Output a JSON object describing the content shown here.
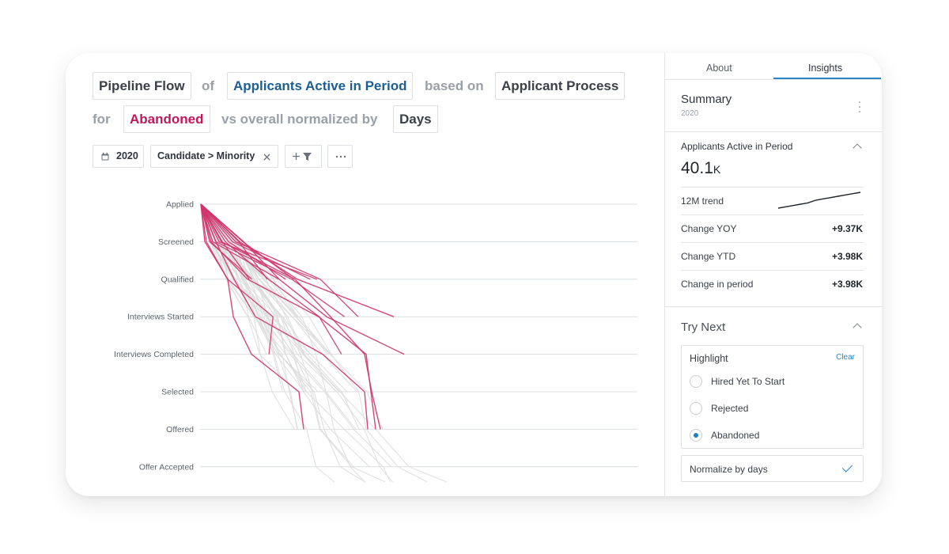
{
  "query": {
    "view": "Pipeline Flow",
    "of_word": "of",
    "population": "Applicants Active in Period",
    "based_on_word": "based on",
    "process": "Applicant Process",
    "for_word": "for",
    "highlight": "Abandoned",
    "vs_word": "vs overall normalized by",
    "normalize_unit": "Days"
  },
  "filters": {
    "year": "2020",
    "segment": "Candidate > Minority",
    "add_filter_icon": "plus-filter-icon",
    "more_icon": "ellipsis-icon"
  },
  "chart_data": {
    "type": "flow",
    "stages": [
      "Applied",
      "Screened",
      "Qualified",
      "Interviews Started",
      "Interviews Completed",
      "Selected",
      "Offered",
      "Offer Accepted"
    ],
    "highlight_color": "#d0336a",
    "overall_color": "#dddddd"
  },
  "sidebar": {
    "tabs": [
      {
        "label": "About",
        "active": false
      },
      {
        "label": "Insights",
        "active": true
      }
    ],
    "summary": {
      "title": "Summary",
      "year": "2020"
    },
    "metric": {
      "title": "Applicants Active in Period",
      "value": "40.1",
      "unit": "K",
      "trend_label": "12M trend",
      "trend_points": [
        38.9,
        39.0,
        39.1,
        39.2,
        39.3,
        39.5,
        39.6,
        39.7,
        39.8,
        39.9,
        40.0,
        40.1
      ],
      "rows": [
        {
          "label": "Change YOY",
          "value": "+9.37K"
        },
        {
          "label": "Change YTD",
          "value": "+3.98K"
        },
        {
          "label": "Change in period",
          "value": "+3.98K"
        }
      ]
    },
    "try_next": {
      "title": "Try Next",
      "highlight_title": "Highlight",
      "clear_label": "Clear",
      "options": [
        {
          "label": "Hired Yet To Start",
          "selected": false
        },
        {
          "label": "Rejected",
          "selected": false
        },
        {
          "label": "Abandoned",
          "selected": true
        }
      ],
      "normalize_label": "Normalize by days",
      "normalize_checked": true
    }
  },
  "colors": {
    "accent_blue": "#2a86c6",
    "population_text": "#1b5f93",
    "highlight_pink": "#c2185b"
  }
}
